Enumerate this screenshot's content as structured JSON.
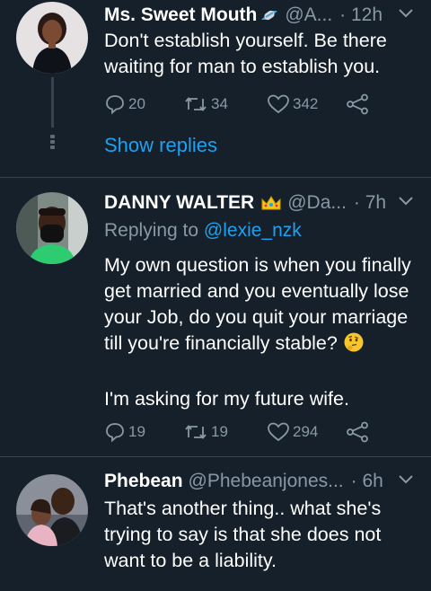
{
  "tweets": [
    {
      "name": "Ms. Sweet Mouth",
      "badge_icon": "candy-emoji",
      "handle": "@A...",
      "time": "· 12h",
      "body_lines": [
        "Don't establish yourself. Be there waiting for man to establish you."
      ],
      "replies": "20",
      "retweets": "34",
      "likes": "342",
      "show_replies": "Show replies"
    },
    {
      "name": "DANNY WALTER",
      "badge_icon": "crown-emoji",
      "handle": "@Da...",
      "time": "· 7h",
      "replying_prefix": "Replying to",
      "replying_to": "@lexie_nzk",
      "body_lines": [
        "My own question is when you finally get married and you eventually lose your Job, do you quit your marriage till you're financially stable?",
        "I'm asking for my future wife."
      ],
      "trailing_emoji": "thinking-face-emoji",
      "replies": "19",
      "retweets": "19",
      "likes": "294"
    },
    {
      "name": "Phebean",
      "handle": "@Phebeanjones...",
      "time": "· 6h",
      "body_lines": [
        "That's another thing.. what she's trying to say is that she does not want to be a liability."
      ]
    }
  ],
  "colors": {
    "background": "#15202b",
    "divider": "#38444d",
    "muted_text": "#8899a6",
    "link": "#1da1f2",
    "text": "#ffffff"
  }
}
